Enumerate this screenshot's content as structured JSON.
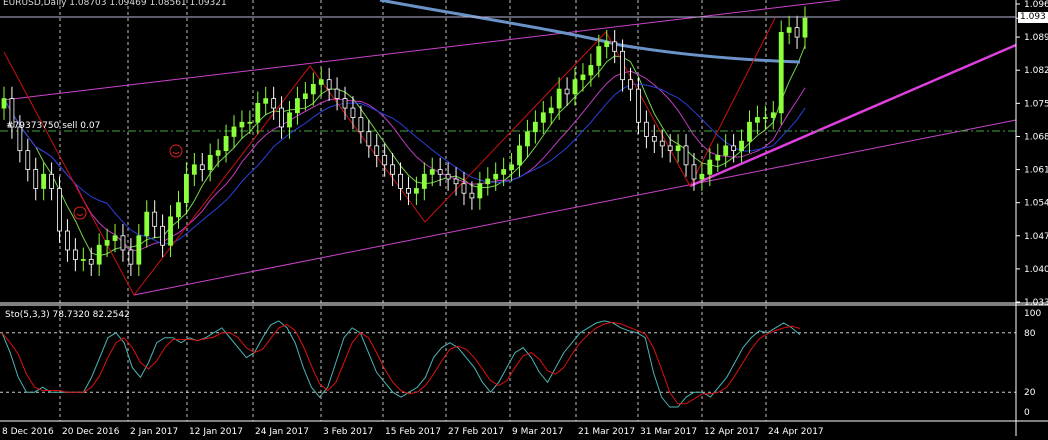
{
  "header": {
    "symbol": "EURUSD,Daily",
    "ohlc": "1.08703 1.09469 1.08561 1.09321"
  },
  "order_line": {
    "label": "#79373750 sell 0.07"
  },
  "stochastic": {
    "header": "Sto(5,3,3) 78.7320 82.2542"
  },
  "current_price": "1.093",
  "colors": {
    "background": "#000000",
    "bull": "#8cff3c",
    "bear": "#ffffff",
    "ma_blue": "#6b93c8",
    "trendline_magenta": "#cc44cc",
    "zigzag": "#cc1111",
    "ma_fast": "#76d34a",
    "ma_mid": "#c23bc2",
    "ma_slow": "#2a3fd9",
    "order_line": "#3fa63f",
    "stoch_main": "#4fb3b3",
    "stoch_signal": "#dd1111"
  },
  "chart_data": {
    "type": "candlestick",
    "price_axis": [
      "1.096",
      "1.093",
      "1.089",
      "1.082",
      "1.075",
      "1.068",
      "1.061",
      "1.054",
      "1.047",
      "1.040",
      "1.033"
    ],
    "stoch_axis": [
      "100",
      "80",
      "20",
      "0"
    ],
    "date_axis": [
      "8 Dec 2016",
      "20 Dec 2016",
      "2 Jan 2017",
      "12 Jan 2017",
      "24 Jan 2017",
      "3 Feb 2017",
      "15 Feb 2017",
      "27 Feb 2017",
      "9 Mar 2017",
      "21 Mar 2017",
      "31 Mar 2017",
      "12 Apr 2017",
      "24 Apr 2017"
    ],
    "ylim": [
      1.033,
      1.096
    ],
    "stoch_levels": [
      80,
      20
    ],
    "grid": "vertical dashed at date ticks",
    "closes": [
      1.076,
      1.07,
      1.065,
      1.061,
      1.057,
      1.06,
      1.057,
      1.048,
      1.044,
      1.042,
      1.042,
      1.041,
      1.045,
      1.046,
      1.047,
      1.044,
      1.041,
      1.047,
      1.052,
      1.049,
      1.045,
      1.051,
      1.054,
      1.06,
      1.062,
      1.061,
      1.064,
      1.065,
      1.068,
      1.07,
      1.071,
      1.071,
      1.075,
      1.076,
      1.074,
      1.07,
      1.073,
      1.076,
      1.077,
      1.079,
      1.08,
      1.078,
      1.076,
      1.074,
      1.072,
      1.069,
      1.066,
      1.064,
      1.062,
      1.06,
      1.057,
      1.056,
      1.057,
      1.06,
      1.061,
      1.06,
      1.059,
      1.058,
      1.056,
      1.055,
      1.058,
      1.059,
      1.06,
      1.061,
      1.062,
      1.066,
      1.069,
      1.071,
      1.073,
      1.074,
      1.078,
      1.077,
      1.08,
      1.081,
      1.083,
      1.087,
      1.088,
      1.086,
      1.08,
      1.078,
      1.071,
      1.068,
      1.067,
      1.066,
      1.065,
      1.066,
      1.062,
      1.059,
      1.06,
      1.063,
      1.064,
      1.066,
      1.065,
      1.067,
      1.071,
      1.072,
      1.072,
      1.073,
      1.09,
      1.091,
      1.089,
      1.093
    ],
    "stoch_main": [
      80,
      60,
      35,
      20,
      20,
      25,
      20,
      20,
      20,
      20,
      20,
      35,
      55,
      75,
      80,
      70,
      45,
      35,
      50,
      70,
      75,
      75,
      70,
      75,
      72,
      75,
      80,
      85,
      75,
      65,
      55,
      60,
      75,
      88,
      92,
      85,
      70,
      45,
      25,
      15,
      25,
      50,
      75,
      85,
      80,
      60,
      40,
      30,
      20,
      15,
      20,
      25,
      35,
      55,
      65,
      70,
      65,
      55,
      45,
      30,
      20,
      30,
      45,
      60,
      65,
      55,
      40,
      30,
      45,
      60,
      70,
      80,
      85,
      90,
      92,
      90,
      85,
      82,
      80,
      75,
      40,
      15,
      5,
      5,
      15,
      20,
      20,
      15,
      25,
      35,
      50,
      65,
      75,
      82,
      80,
      85,
      90,
      85,
      78
    ]
  }
}
